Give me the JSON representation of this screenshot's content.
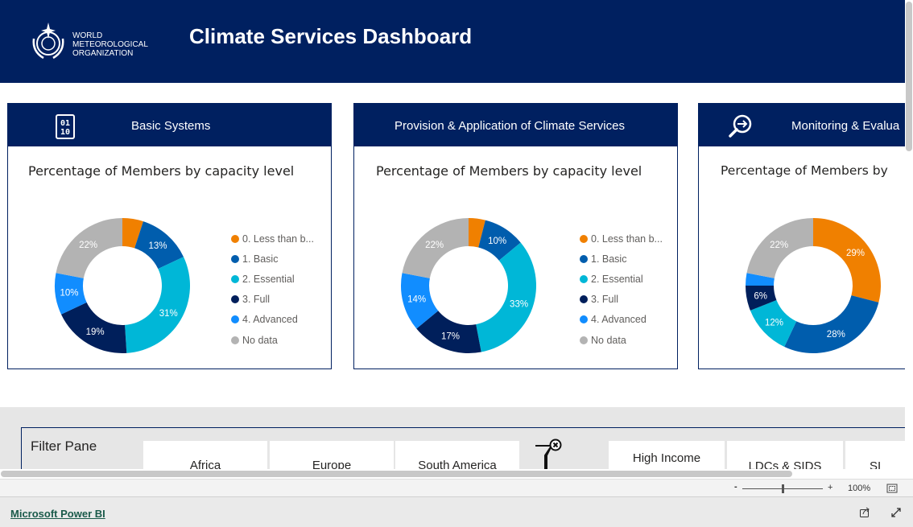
{
  "header": {
    "org_logo_text": [
      "WORLD",
      "METEOROLOGICAL",
      "ORGANIZATION"
    ],
    "title": "Climate Services Dashboard"
  },
  "legend": [
    "0. Less than b...",
    "1. Basic",
    "2. Essential",
    "3. Full",
    "4. Advanced",
    "No data"
  ],
  "colors": [
    "#f08000",
    "#005dad",
    "#00b7d7",
    "#001f5b",
    "#118dff",
    "#b3b3b3"
  ],
  "panels": [
    {
      "title": "Basic Systems",
      "icon": "binary-icon",
      "chart_title": "Percentage of Members by capacity level"
    },
    {
      "title": "Provision & Application of Climate Services",
      "icon": "",
      "chart_title": "Percentage of Members by capacity level"
    },
    {
      "title": "Monitoring & Evalua",
      "icon": "search-arrow-icon",
      "chart_title": "Percentage of Members by"
    }
  ],
  "chart_data": [
    {
      "type": "pie",
      "donut": true,
      "title": "Percentage of Members by capacity level",
      "categories": [
        "0. Less than b...",
        "1. Basic",
        "2. Essential",
        "3. Full",
        "4. Advanced",
        "No data"
      ],
      "values": [
        5,
        13,
        31,
        19,
        10,
        22
      ],
      "labels": [
        "",
        "13%",
        "31%",
        "19%",
        "10%",
        "22%"
      ],
      "legend": "right"
    },
    {
      "type": "pie",
      "donut": true,
      "title": "Percentage of Members by capacity level",
      "categories": [
        "0. Less than b...",
        "1. Basic",
        "2. Essential",
        "3. Full",
        "4. Advanced",
        "No data"
      ],
      "values": [
        4,
        10,
        33,
        17,
        14,
        22
      ],
      "labels": [
        "",
        "10%",
        "33%",
        "17%",
        "14%",
        "22%"
      ],
      "legend": "right"
    },
    {
      "type": "pie",
      "donut": true,
      "title": "Percentage of Members by",
      "categories": [
        "0. Less than b...",
        "1. Basic",
        "2. Essential",
        "3. Full",
        "4. Advanced",
        "No data"
      ],
      "values": [
        29,
        28,
        12,
        6,
        3,
        22
      ],
      "labels": [
        "29%",
        "28%",
        "12%",
        "6%",
        "",
        "22%"
      ]
    }
  ],
  "filter": {
    "title": "Filter Pane",
    "slicers": [
      "Africa",
      "Europe",
      "South America",
      "High Income",
      "LDCs & SIDS",
      "SI"
    ]
  },
  "zoom": {
    "minus": "-",
    "plus": "+",
    "level": "100%",
    "slider_percent": 50
  },
  "footer": {
    "link": "Microsoft Power BI"
  }
}
